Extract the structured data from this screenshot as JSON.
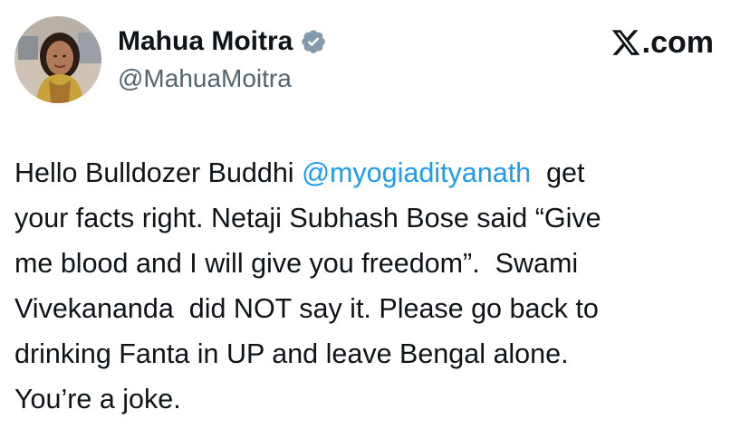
{
  "author": {
    "display_name": "Mahua Moitra",
    "handle": "@MahuaMoitra",
    "verified_icon": "verified-badge-icon",
    "avatar": "profile-photo"
  },
  "brand": {
    "suffix": ".com",
    "logo_icon": "x-logo-icon"
  },
  "tweet": {
    "line1_pre": "Hello Bulldozer Buddhi ",
    "mention": "@myogiadityanath",
    "line1_post": "  get",
    "line2": "your facts right. Netaji Subhash Bose said “Give",
    "line3": "me blood and I will give you freedom”.  Swami",
    "line4": "Vivekananda  did NOT say it. Please go back to",
    "line5": "drinking Fanta in UP and leave Bengal alone.",
    "line6": "You’re a joke."
  },
  "colors": {
    "text": "#0f1419",
    "secondary": "#536471",
    "link": "#1d9bf0",
    "background": "#ffffff"
  }
}
